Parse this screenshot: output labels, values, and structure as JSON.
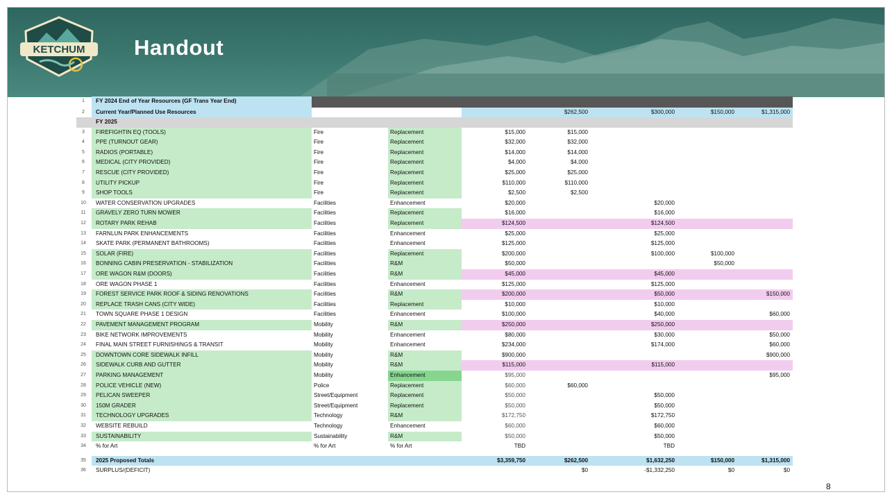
{
  "header": {
    "logo_text": "KETCHUM",
    "title": "Handout"
  },
  "page_number": "8",
  "rows": [
    {
      "n": "1",
      "name": "FY 2024 End of Year Resources (GF Trans Year End)"
    },
    {
      "n": "2",
      "name": "Current Year/Planned Use Resources",
      "c1": "$262,500",
      "c2": "$300,000",
      "c3": "$150,000",
      "c4": "$1,315,000"
    },
    {
      "n": "",
      "name": "FY 2025"
    },
    {
      "n": "3",
      "name": "FIREFIGHTIN EQ (TOOLS)",
      "cat": "Fire",
      "type": "Replacement",
      "amt": "$15,000",
      "c1": "$15,000"
    },
    {
      "n": "4",
      "name": "PPE (TURNOUT GEAR)",
      "cat": "Fire",
      "type": "Replacement",
      "amt": "$32,000",
      "c1": "$32,000"
    },
    {
      "n": "5",
      "name": "RADIOS (PORTABLE)",
      "cat": "Fire",
      "type": "Replacement",
      "amt": "$14,000",
      "c1": "$14,000"
    },
    {
      "n": "6",
      "name": "MEDICAL (CITY PROVIDED)",
      "cat": "Fire",
      "type": "Replacement",
      "amt": "$4,000",
      "c1": "$4,000"
    },
    {
      "n": "7",
      "name": "RESCUE (CITY PROVIDED)",
      "cat": "Fire",
      "type": "Replacement",
      "amt": "$25,000",
      "c1": "$25,000"
    },
    {
      "n": "8",
      "name": "UTILITY PICKUP",
      "cat": "Fire",
      "type": "Replacement",
      "amt": "$110,000",
      "c1": "$110,000"
    },
    {
      "n": "9",
      "name": "SHOP TOOLS",
      "cat": "Fire",
      "type": "Replacement",
      "amt": "$2,500",
      "c1": "$2,500"
    },
    {
      "n": "10",
      "name": "WATER CONSERVATION UPGRADES",
      "cat": "Facilities",
      "type": "Enhancement",
      "amt": "$20,000",
      "c2": "$20,000"
    },
    {
      "n": "11",
      "name": "GRAVELY ZERO TURN MOWER",
      "cat": "Facilities",
      "type": "Replacement",
      "amt": "$16,000",
      "c2": "$16,000"
    },
    {
      "n": "12",
      "name": "ROTARY PARK REHAB",
      "cat": "Facilities",
      "type": "Replacement",
      "amt": "$124,500",
      "c2": "$124,500"
    },
    {
      "n": "13",
      "name": "FARNLUN PARK ENHANCEMENTS",
      "cat": "Facilities",
      "type": "Enhancement",
      "amt": "$25,000",
      "c2": "$25,000"
    },
    {
      "n": "14",
      "name": "SKATE PARK (PERMANENT BATHROOMS)",
      "cat": "Facilities",
      "type": "Enhancement",
      "amt": "$125,000",
      "c2": "$125,000"
    },
    {
      "n": "15",
      "name": "SOLAR (FIRE)",
      "cat": "Facilities",
      "type": "Replacement",
      "amt": "$200,000",
      "c2": "$100,000",
      "c3": "$100,000"
    },
    {
      "n": "16",
      "name": "BONNING CABIN PRESERVATION - STABILIZATION",
      "cat": "Facilities",
      "type": "R&M",
      "amt": "$50,000",
      "c3": "$50,000"
    },
    {
      "n": "17",
      "name": "ORE WAGON R&M (DOORS)",
      "cat": "Facilities",
      "type": "R&M",
      "amt": "$45,000",
      "c2": "$45,000"
    },
    {
      "n": "18",
      "name": "ORE WAGON PHASE 1",
      "cat": "Facilities",
      "type": "Enhancement",
      "amt": "$125,000",
      "c2": "$125,000"
    },
    {
      "n": "19",
      "name": "FOREST SERVICE PARK ROOF & SIDING RENOVATIONS",
      "cat": "Facilities",
      "type": "R&M",
      "amt": "$200,000",
      "c2": "$50,000",
      "c4": "$150,000"
    },
    {
      "n": "20",
      "name": "REPLACE TRASH CANS (CITY WIDE)",
      "cat": "Facilities",
      "type": "Replacement",
      "amt": "$10,000",
      "c2": "$10,000"
    },
    {
      "n": "21",
      "name": "TOWN SQUARE PHASE 1 DESIGN",
      "cat": "Facilities",
      "type": "Enhancement",
      "amt": "$100,000",
      "c2": "$40,000",
      "c4": "$60,000"
    },
    {
      "n": "22",
      "name": "PAVEMENT MANAGEMENT PROGRAM",
      "cat": "Mobility",
      "type": "R&M",
      "amt": "$250,000",
      "c2": "$250,000"
    },
    {
      "n": "23",
      "name": "BIKE NETWORK IMPROVEMENTS",
      "cat": "Mobility",
      "type": "Enhancement",
      "amt": "$80,000",
      "c2": "$30,000",
      "c4": "$50,000"
    },
    {
      "n": "24",
      "name": "FINAL MAIN STREET FURNISHINGS & TRANSIT",
      "cat": "Mobility",
      "type": "Enhancement",
      "amt": "$234,000",
      "c2": "$174,000",
      "c4": "$60,000"
    },
    {
      "n": "25",
      "name": "DOWNTOWN CORE SIDEWALK INFILL",
      "cat": "Mobility",
      "type": "R&M",
      "amt": "$900,000",
      "c4": "$900,000"
    },
    {
      "n": "26",
      "name": "SIDEWALK CURB AND GUTTER",
      "cat": "Mobility",
      "type": "R&M",
      "amt": "$115,000",
      "c2": "$115,000"
    },
    {
      "n": "27",
      "name": "PARKING MANAGEMENT",
      "cat": "Mobility",
      "type": "Enhancement",
      "amt": "$95,000",
      "c4": "$95,000"
    },
    {
      "n": "28",
      "name": "POLICE VEHICLE (NEW)",
      "cat": "Police",
      "type": "Replacement",
      "amt": "$60,000",
      "c1": "$60,000"
    },
    {
      "n": "29",
      "name": "PELICAN SWEEPER",
      "cat": "Street/Equipment",
      "type": "Replacement",
      "amt": "$50,000",
      "c2": "$50,000"
    },
    {
      "n": "30",
      "name": "150M GRADER",
      "cat": "Street/Equipment",
      "type": "Replacement",
      "amt": "$50,000",
      "c2": "$50,000"
    },
    {
      "n": "31",
      "name": "TECHNOLOGY UPGRADES",
      "cat": "Technology",
      "type": "R&M",
      "amt": "$172,750",
      "c2": "$172,750"
    },
    {
      "n": "32",
      "name": "WEBSITE REBUILD",
      "cat": "Technology",
      "type": "Enhancement",
      "amt": "$60,000",
      "c2": "$60,000"
    },
    {
      "n": "33",
      "name": "SUSTAINABILITY",
      "cat": "Sustainability",
      "type": "R&M",
      "amt": "$50,000",
      "c2": "$50,000"
    },
    {
      "n": "34",
      "name": "% for Art",
      "cat": "% for Art",
      "type": "% for Art",
      "amt": "TBD",
      "c2": "TBD"
    },
    {
      "n": "35",
      "name": "2025 Proposed Totals",
      "amt": "$3,359,750",
      "c1": "$262,500",
      "c2": "$1,632,250",
      "c3": "$150,000",
      "c4": "$1,315,000"
    },
    {
      "n": "36",
      "name": "SURPLUS/(DEFICIT)",
      "c1": "$0",
      "c2": "-$1,332,250",
      "c3": "$0",
      "c4": "$0"
    }
  ]
}
